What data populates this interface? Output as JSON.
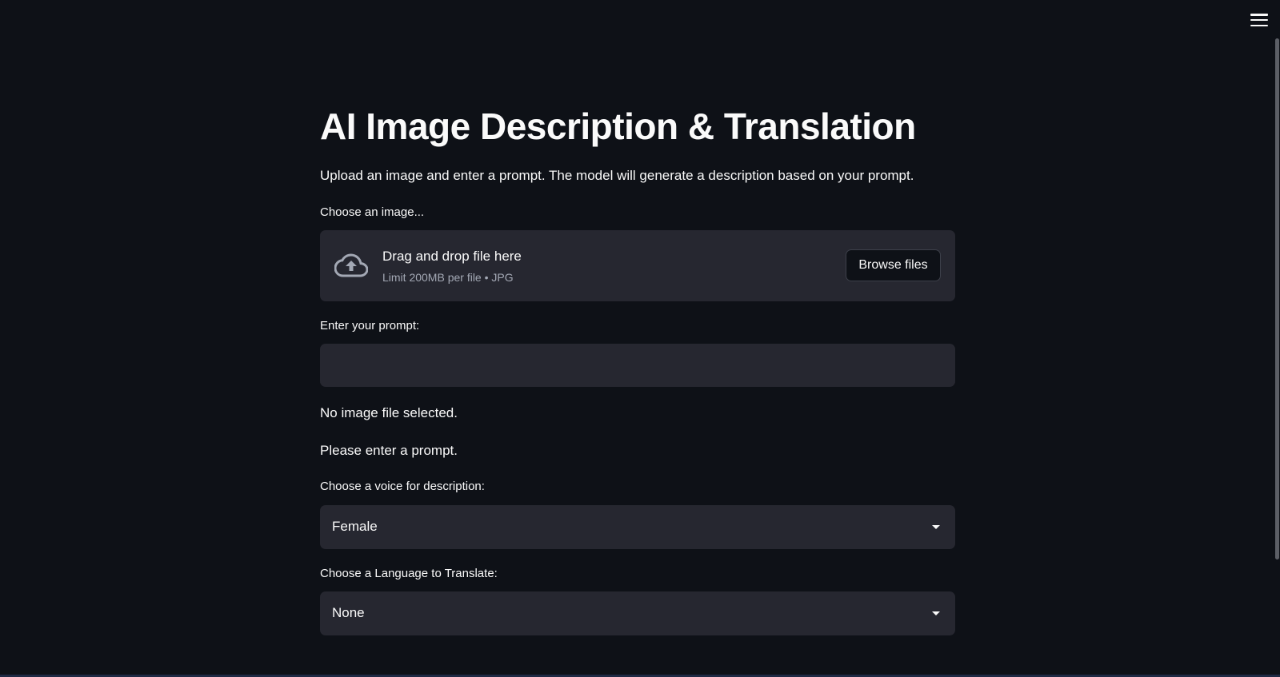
{
  "header": {
    "menu_icon": "hamburger-menu-icon"
  },
  "main": {
    "title": "AI Image Description & Translation",
    "intro": "Upload an image and enter a prompt. The model will generate a description based on your prompt.",
    "uploader": {
      "label": "Choose an image...",
      "drop_title": "Drag and drop file here",
      "limit_text": "Limit 200MB per file • JPG",
      "browse_label": "Browse files",
      "icon": "cloud-upload-icon"
    },
    "prompt": {
      "label": "Enter your prompt:",
      "value": "",
      "placeholder": ""
    },
    "status": {
      "no_image": "No image file selected.",
      "enter_prompt": "Please enter a prompt."
    },
    "voice_select": {
      "label": "Choose a voice for description:",
      "value": "Female",
      "icon": "chevron-down-icon"
    },
    "language_select": {
      "label": "Choose a Language to Translate:",
      "value": "None",
      "icon": "chevron-down-icon"
    }
  },
  "colors": {
    "background": "#0e1117",
    "surface": "#262730",
    "text": "#fafafa",
    "muted_text": "#a3a8b4"
  }
}
